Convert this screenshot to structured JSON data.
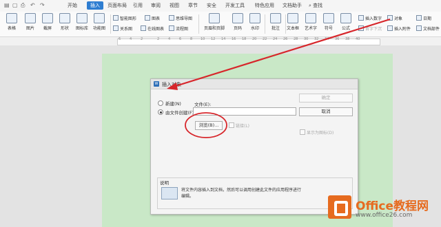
{
  "menubar": {
    "tabs": [
      "开始",
      "插入",
      "页面布局",
      "引用",
      "审阅",
      "视图",
      "章节",
      "安全",
      "开发工具",
      "特色应用",
      "文档助手"
    ],
    "active_tab": "插入",
    "search_label": "查找"
  },
  "ribbon": {
    "table": "表格",
    "picture": "图片",
    "screenshot": "截屏",
    "shapes": "形状",
    "icons": "图标库",
    "feature_icons": "功能图",
    "smartart": "智能图形",
    "chart": "图表",
    "mindmap": "思维导图",
    "relation": "关系图",
    "online_chart": "在线图表",
    "flowchart": "流程图",
    "header_footer": "页眉和页脚",
    "page_number": "页码",
    "watermark": "水印",
    "comment": "批注",
    "textbox": "文本框",
    "wordart": "艺术字",
    "symbol": "符号",
    "formula": "公式",
    "insert_number": "插入数字",
    "object": "对象",
    "date": "日期",
    "first_drop": "首字下沉",
    "attachment": "插入附件",
    "doc_parts": "文档部件"
  },
  "ruler": {
    "numbers": [
      "6",
      "4",
      "2",
      "2",
      "4",
      "6",
      "8",
      "10",
      "12",
      "14",
      "16",
      "18",
      "20",
      "22",
      "24",
      "26",
      "28",
      "30",
      "32",
      "34",
      "36",
      "38",
      "40"
    ]
  },
  "dialog": {
    "title": "插入对象",
    "radio_new": "新建(N)",
    "radio_from_file": "由文件创建(F)",
    "file_label": "文件(E):",
    "file_value": "",
    "browse_button": "浏览(B)...",
    "link_checkbox": "链接(L)",
    "ok_button": "确定",
    "cancel_button": "取消",
    "show_as_icon": "显示为图标(D)",
    "desc_title": "说明",
    "desc_text": "将文件内容插入到文档，然后可以调用创建此文件的应用程序进行编辑。"
  },
  "watermark": {
    "name": "Office教程网",
    "url": "www.office26.com"
  },
  "colors": {
    "accent": "#2e7dd1",
    "page": "#c9e8c7",
    "annotation": "#d7262b",
    "brand": "#e66b1f"
  }
}
